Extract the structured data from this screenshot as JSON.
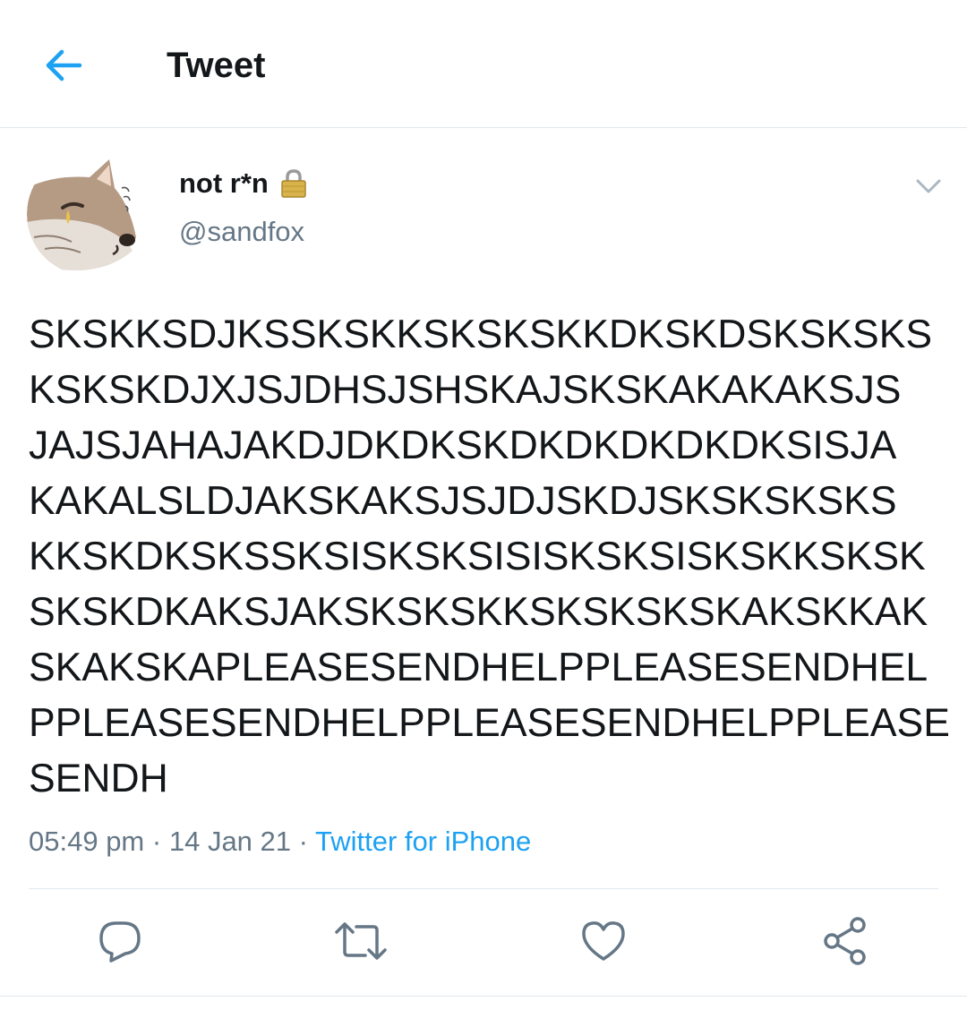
{
  "header": {
    "back_icon": "arrow-left-icon",
    "title": "Tweet"
  },
  "tweet": {
    "author": {
      "display_name": "not r*n",
      "lock_icon": "lock-icon",
      "handle": "@sandfox"
    },
    "text_lines": [
      "SKSKKSDJKSSKSKKSKSKSKKDKSKDSKSKSKS",
      "KSKSKDJXJSJDHSJSHSKAJSKSKAKAKAKSJS",
      "JAJSJAHAJAKDJDKDKSKDKDKDKDKDKSISJA",
      "KAKALSLDJAKSKAKSJSJDJSKDJSKSKSKSKS",
      "KKSKDKSKSSKSISKSKSISISKSKSISKSKKSKSK",
      "SKSKDKAKSJAKSKSKSKKSKSKSKSKAKSKKAK",
      "SKAKSKAPLEASESENDHELPPLEASESENDHEL",
      "PPLEASESENDHELPPLEASESENDHELPPLEASE",
      "SENDH"
    ],
    "time": "05:49 pm",
    "separator": "·",
    "date": "14 Jan 21",
    "source": "Twitter for iPhone"
  },
  "actions": {
    "reply_icon": "reply-icon",
    "retweet_icon": "retweet-icon",
    "like_icon": "heart-icon",
    "share_icon": "share-icon"
  },
  "colors": {
    "accent": "#1da1f2",
    "secondary_text": "#657786",
    "primary_text": "#14171a",
    "divider": "#e1e8ed"
  }
}
